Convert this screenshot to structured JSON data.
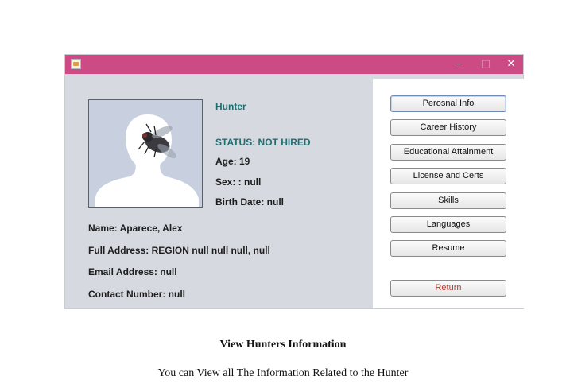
{
  "profile": {
    "role": "Hunter",
    "status": "STATUS: NOT HIRED",
    "age": "Age: 19",
    "sex": "Sex: : null",
    "birth_date": "Birth Date: null",
    "name": "Name: Aparece, Alex",
    "full_address": "Full Address: REGION null null null, null",
    "email": "Email Address: null",
    "contact": "Contact Number: null"
  },
  "menu": {
    "personal_info": "Perosnal Info",
    "career_history": "Career History",
    "education": "Educational Attainment",
    "license": "License and Certs",
    "skills": "Skills",
    "languages": "Languages",
    "resume": "Resume",
    "return": "Return"
  },
  "window": {
    "controls": {
      "minimize": "–",
      "maximize": "□",
      "close": "✕"
    }
  },
  "caption": {
    "title": "View Hunters Information",
    "description": "You can View all The Information Related to the Hunter"
  },
  "colors": {
    "titlebar": "#cc4b84",
    "window_bg": "#d6d9e0",
    "status_teal": "#1f6f72",
    "return_red": "#c0392b"
  }
}
